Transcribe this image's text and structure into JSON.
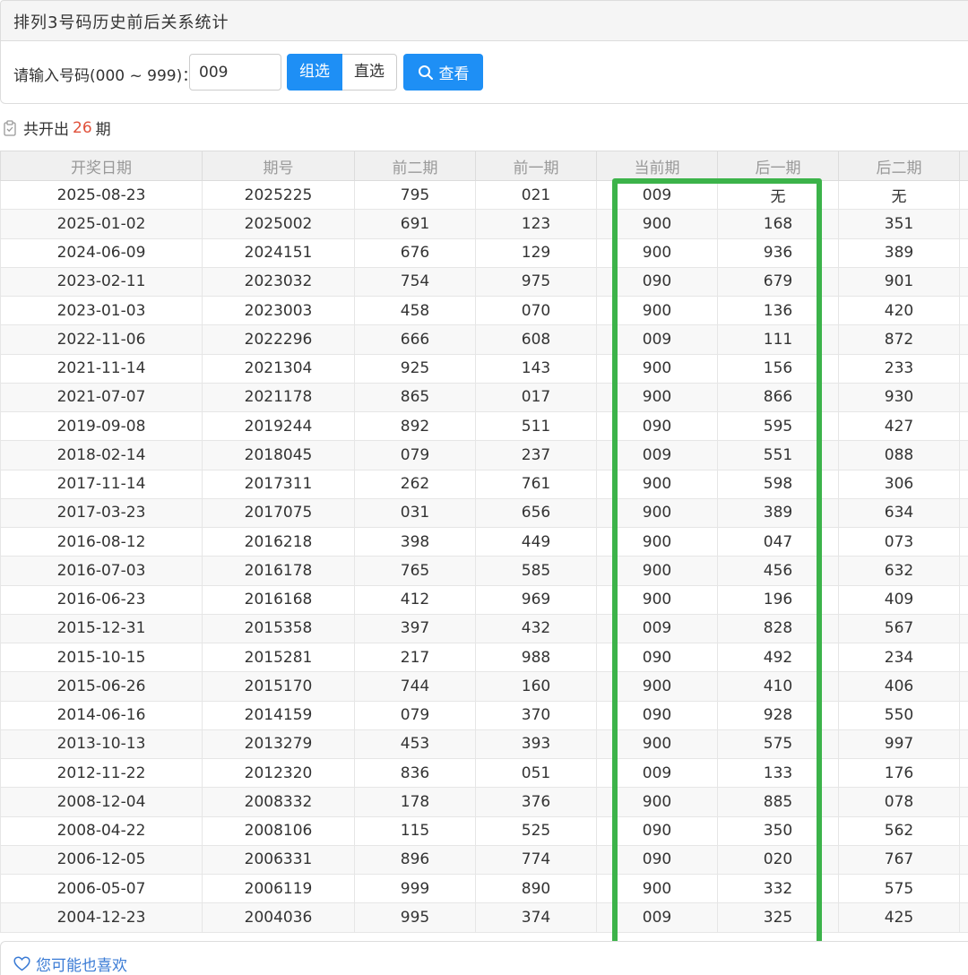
{
  "header": {
    "title": "排列3号码历史前后关系统计"
  },
  "search": {
    "label": "请输入号码(000 ~ 999)：",
    "input_value": "009",
    "mode_group": "组选",
    "mode_direct": "直选",
    "query_label": "查看"
  },
  "summary": {
    "prefix": "共开出",
    "count": "26",
    "suffix": "期"
  },
  "table": {
    "headers": [
      "开奖日期",
      "期号",
      "前二期",
      "前一期",
      "当前期",
      "后一期",
      "后二期"
    ],
    "rows": [
      [
        "2025-08-23",
        "2025225",
        "795",
        "021",
        "009",
        "无",
        "无"
      ],
      [
        "2025-01-02",
        "2025002",
        "691",
        "123",
        "900",
        "168",
        "351"
      ],
      [
        "2024-06-09",
        "2024151",
        "676",
        "129",
        "900",
        "936",
        "389"
      ],
      [
        "2023-02-11",
        "2023032",
        "754",
        "975",
        "090",
        "679",
        "901"
      ],
      [
        "2023-01-03",
        "2023003",
        "458",
        "070",
        "900",
        "136",
        "420"
      ],
      [
        "2022-11-06",
        "2022296",
        "666",
        "608",
        "009",
        "111",
        "872"
      ],
      [
        "2021-11-14",
        "2021304",
        "925",
        "143",
        "900",
        "156",
        "233"
      ],
      [
        "2021-07-07",
        "2021178",
        "865",
        "017",
        "900",
        "866",
        "930"
      ],
      [
        "2019-09-08",
        "2019244",
        "892",
        "511",
        "090",
        "595",
        "427"
      ],
      [
        "2018-02-14",
        "2018045",
        "079",
        "237",
        "009",
        "551",
        "088"
      ],
      [
        "2017-11-14",
        "2017311",
        "262",
        "761",
        "900",
        "598",
        "306"
      ],
      [
        "2017-03-23",
        "2017075",
        "031",
        "656",
        "900",
        "389",
        "634"
      ],
      [
        "2016-08-12",
        "2016218",
        "398",
        "449",
        "900",
        "047",
        "073"
      ],
      [
        "2016-07-03",
        "2016178",
        "765",
        "585",
        "900",
        "456",
        "632"
      ],
      [
        "2016-06-23",
        "2016168",
        "412",
        "969",
        "900",
        "196",
        "409"
      ],
      [
        "2015-12-31",
        "2015358",
        "397",
        "432",
        "009",
        "828",
        "567"
      ],
      [
        "2015-10-15",
        "2015281",
        "217",
        "988",
        "090",
        "492",
        "234"
      ],
      [
        "2015-06-26",
        "2015170",
        "744",
        "160",
        "900",
        "410",
        "406"
      ],
      [
        "2014-06-16",
        "2014159",
        "079",
        "370",
        "090",
        "928",
        "550"
      ],
      [
        "2013-10-13",
        "2013279",
        "453",
        "393",
        "900",
        "575",
        "997"
      ],
      [
        "2012-11-22",
        "2012320",
        "836",
        "051",
        "009",
        "133",
        "176"
      ],
      [
        "2008-12-04",
        "2008332",
        "178",
        "376",
        "900",
        "885",
        "078"
      ],
      [
        "2008-04-22",
        "2008106",
        "115",
        "525",
        "090",
        "350",
        "562"
      ],
      [
        "2006-12-05",
        "2006331",
        "896",
        "774",
        "090",
        "020",
        "767"
      ],
      [
        "2006-05-07",
        "2006119",
        "999",
        "890",
        "900",
        "332",
        "575"
      ],
      [
        "2004-12-23",
        "2004036",
        "995",
        "374",
        "009",
        "325",
        "425"
      ]
    ]
  },
  "footer": {
    "label": "您可能也喜欢"
  },
  "colors": {
    "accent": "#1e8ff5",
    "count": "#e0503a",
    "highlight": "#3cb34a",
    "link": "#3a7bd5"
  },
  "icons": {
    "query": "search-icon",
    "summary": "clipboard-icon",
    "footer": "heart-icon"
  }
}
